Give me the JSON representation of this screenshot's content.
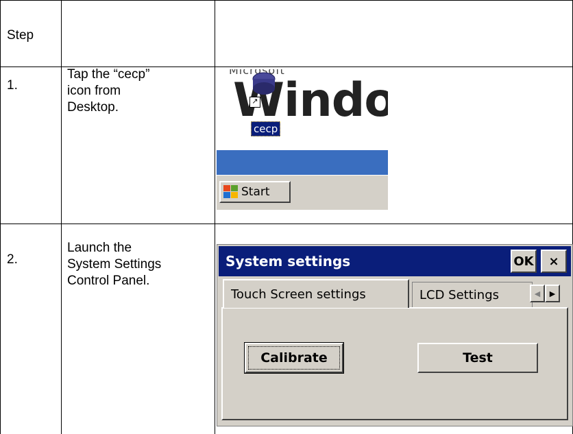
{
  "table": {
    "header": {
      "step": "Step"
    },
    "rows": [
      {
        "number": "1.",
        "instruction": "Tap the “cecp”\nicon from\nDesktop."
      },
      {
        "number": "2.",
        "instruction": "Launch the\nSystem Settings\nControl Panel."
      }
    ]
  },
  "desktop_shot": {
    "wordmark_top": "Microsoft",
    "wordmark": "Windo",
    "icon_label": "cecp",
    "start_label": "Start",
    "colors": {
      "desktop_blue": "#3a6ebf",
      "selection": "#0a1e7a",
      "taskbar": "#d4d0c8"
    }
  },
  "dialog_shot": {
    "title": "System settings",
    "ok_label": "OK",
    "close_label": "×",
    "tabs": [
      {
        "label": "Touch Screen settings",
        "active": true
      },
      {
        "label": "LCD Settings",
        "active": false
      }
    ],
    "calibrate_label": "Calibrate",
    "test_label": "Test",
    "colors": {
      "titlebar": "#0a1e7a",
      "face": "#d4d0c8"
    }
  }
}
